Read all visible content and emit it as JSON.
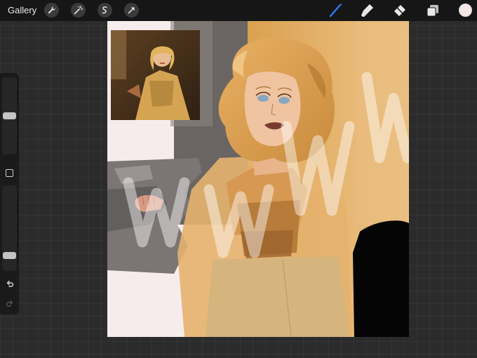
{
  "topbar": {
    "gallery_label": "Gallery",
    "left_tools": [
      "wrench-icon",
      "magic-wand-icon",
      "selection-icon",
      "transform-arrow-icon"
    ],
    "right_tools": [
      "brush-icon",
      "smudge-icon",
      "eraser-icon",
      "layers-icon"
    ],
    "active_tool": "brush-icon",
    "current_color": "#f6e8e6"
  },
  "sidebar": {
    "brush_size": 0.5,
    "opacity": 0.15
  },
  "colors": {
    "active_tool": "#2f7cf6",
    "background": "#2b2b2b",
    "bar": "#161616"
  }
}
